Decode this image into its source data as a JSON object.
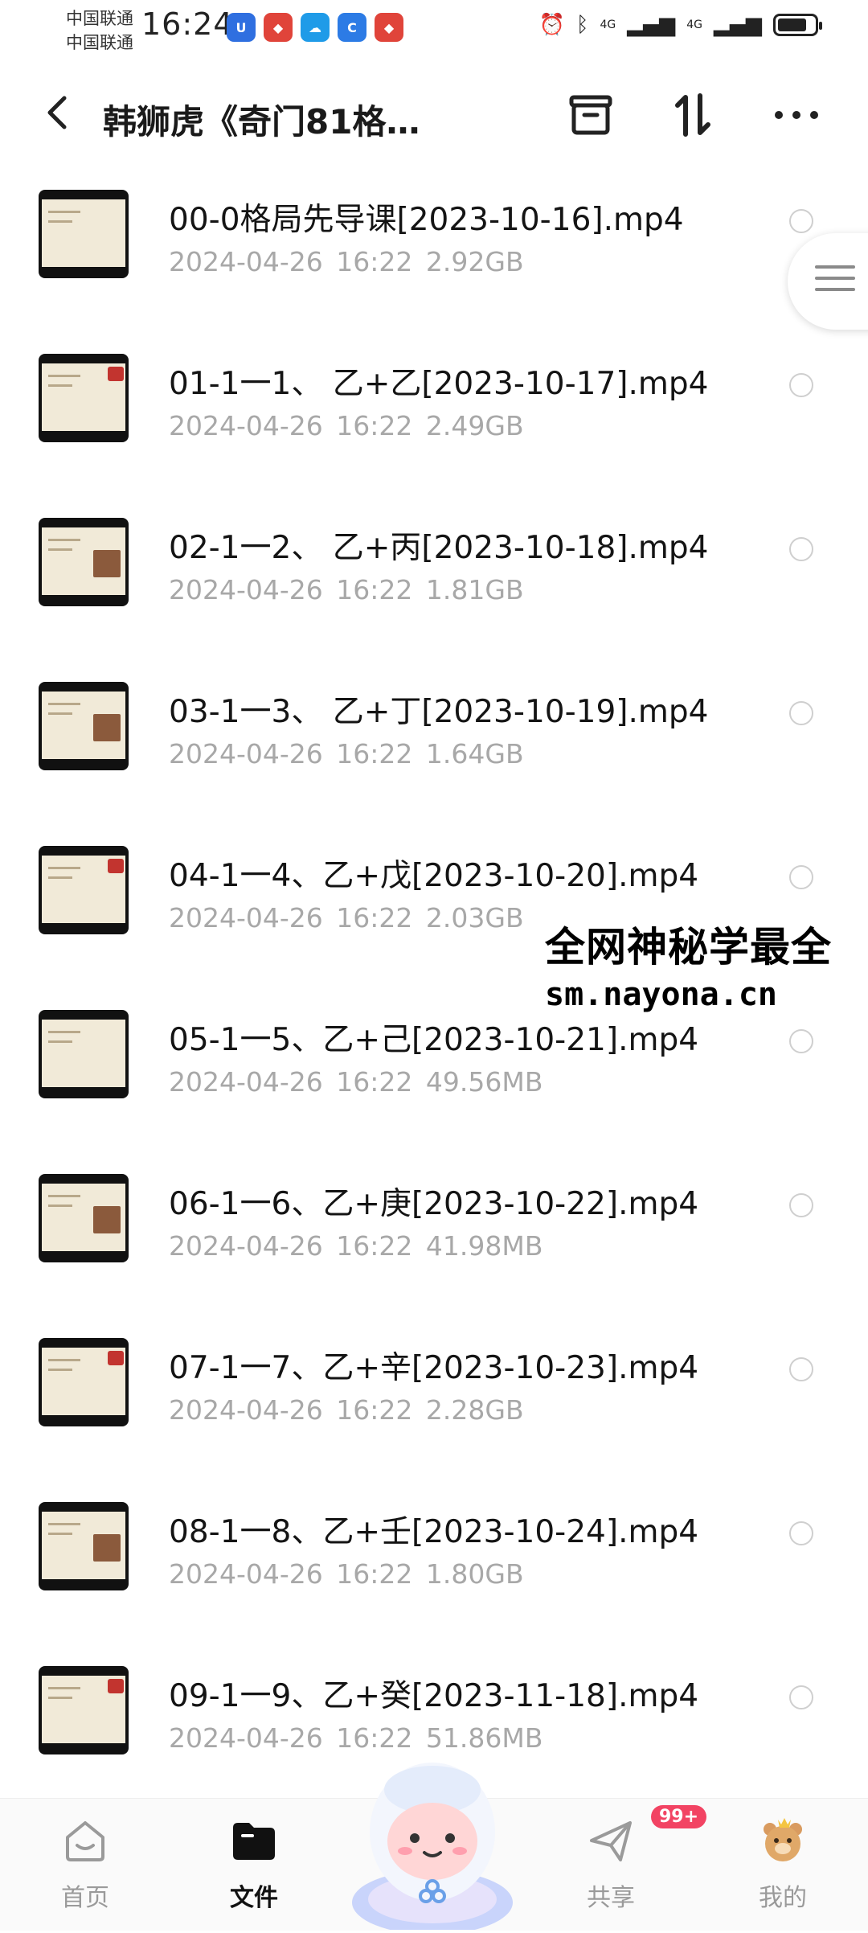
{
  "status_bar": {
    "carrier_1": "中国联通",
    "carrier_2": "中国联通",
    "time": "16:24",
    "net_1": "4G",
    "net_2": "4G"
  },
  "header": {
    "title": "韩狮虎《奇门81格…",
    "back_icon": "chevron-left-icon",
    "archive_icon": "archive-icon",
    "sort_icon": "sort-icon",
    "more_icon": "more-horizontal-icon"
  },
  "files": [
    {
      "name": "00-0格局先导课[2023-10-16].mp4",
      "date": "2024-04-26",
      "time": "16:22",
      "size": "2.92GB"
    },
    {
      "name": "01-1一1、 乙+乙[2023-10-17].mp4",
      "date": "2024-04-26",
      "time": "16:22",
      "size": "2.49GB"
    },
    {
      "name": "02-1一2、 乙+丙[2023-10-18].mp4",
      "date": "2024-04-26",
      "time": "16:22",
      "size": "1.81GB"
    },
    {
      "name": "03-1一3、 乙+丁[2023-10-19].mp4",
      "date": "2024-04-26",
      "time": "16:22",
      "size": "1.64GB"
    },
    {
      "name": "04-1一4、乙+戊[2023-10-20].mp4",
      "date": "2024-04-26",
      "time": "16:22",
      "size": "2.03GB"
    },
    {
      "name": "05-1一5、乙+己[2023-10-21].mp4",
      "date": "2024-04-26",
      "time": "16:22",
      "size": "49.56MB"
    },
    {
      "name": "06-1一6、乙+庚[2023-10-22].mp4",
      "date": "2024-04-26",
      "time": "16:22",
      "size": "41.98MB"
    },
    {
      "name": "07-1一7、乙+辛[2023-10-23].mp4",
      "date": "2024-04-26",
      "time": "16:22",
      "size": "2.28GB"
    },
    {
      "name": "08-1一8、乙+壬[2023-10-24].mp4",
      "date": "2024-04-26",
      "time": "16:22",
      "size": "1.80GB"
    },
    {
      "name": "09-1一9、乙+癸[2023-11-18].mp4",
      "date": "2024-04-26",
      "time": "16:22",
      "size": "51.86MB"
    }
  ],
  "watermark": {
    "line1": "全网神秘学最全",
    "line2": "sm.nayona.cn"
  },
  "bottom_nav": {
    "home": "首页",
    "files": "文件",
    "share": "共享",
    "mine": "我的",
    "share_badge": "99+"
  },
  "colors": {
    "accent_badge": "#f24363",
    "meta_text": "#a8a8a8"
  }
}
